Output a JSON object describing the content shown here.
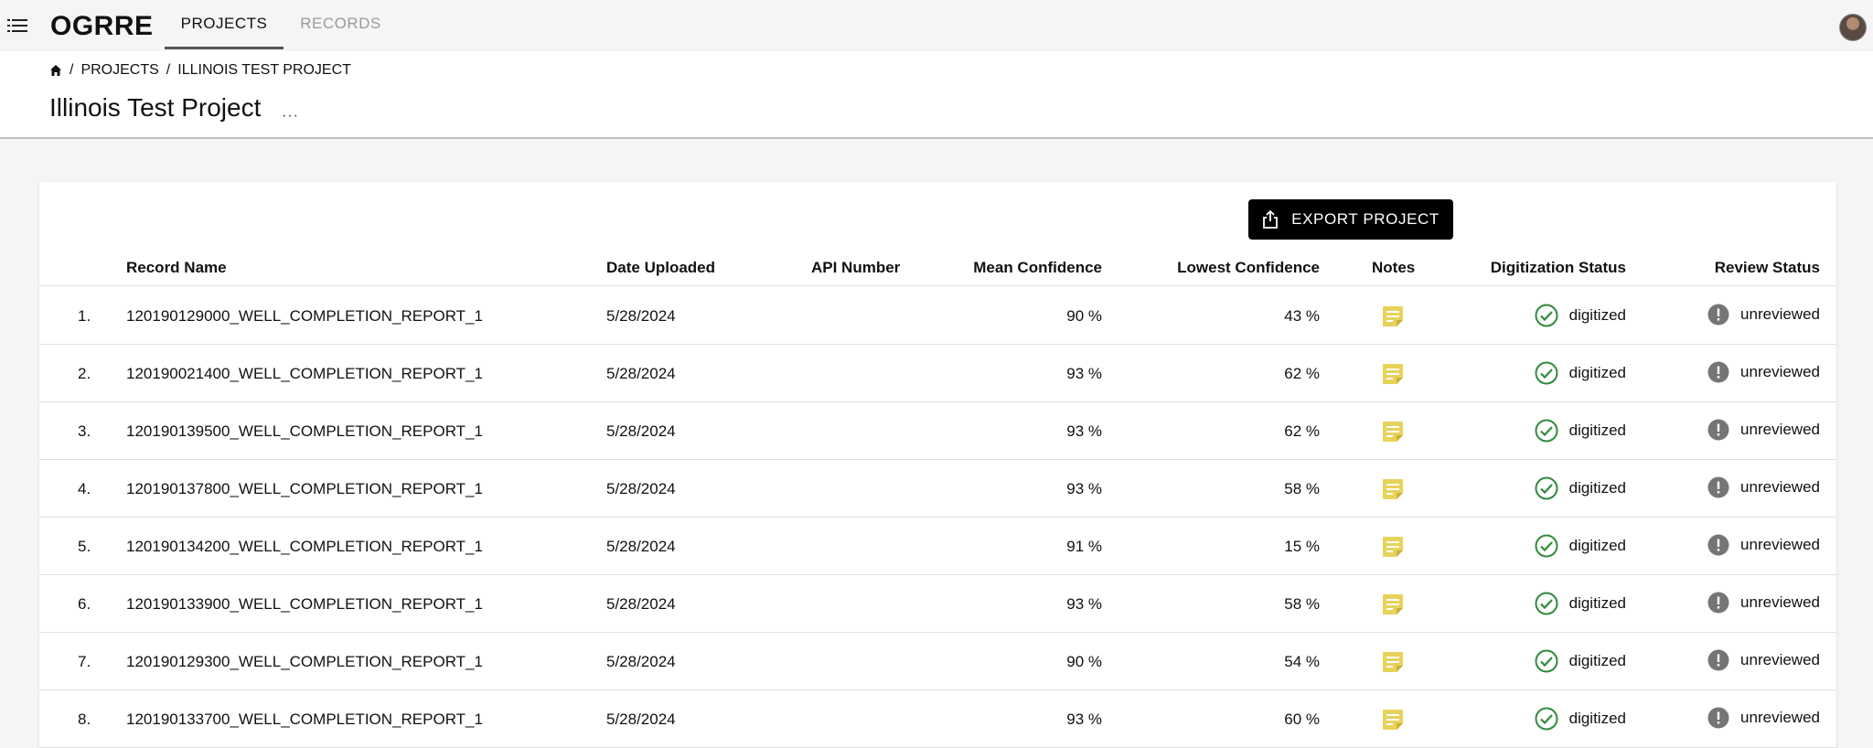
{
  "app": {
    "brand": "OGRRE",
    "nav": {
      "projects": "PROJECTS",
      "records": "RECORDS"
    }
  },
  "breadcrumb": {
    "sep1": "/",
    "projects": "PROJECTS",
    "sep2": "/",
    "current": "ILLINOIS TEST PROJECT"
  },
  "page": {
    "title": "Illinois Test Project",
    "more": "···"
  },
  "actions": {
    "export_label": "EXPORT PROJECT"
  },
  "table": {
    "headers": {
      "record_name": "Record Name",
      "date_uploaded": "Date Uploaded",
      "api_number": "API Number",
      "mean_confidence": "Mean Confidence",
      "lowest_confidence": "Lowest Confidence",
      "notes": "Notes",
      "digitization_status": "Digitization Status",
      "review_status": "Review Status"
    },
    "rows": [
      {
        "index": "1.",
        "name": "120190129000_WELL_COMPLETION_REPORT_1",
        "date": "5/28/2024",
        "api": "",
        "mean": "90 %",
        "lowest": "43 %",
        "digitization": "digitized",
        "review": "unreviewed"
      },
      {
        "index": "2.",
        "name": "120190021400_WELL_COMPLETION_REPORT_1",
        "date": "5/28/2024",
        "api": "",
        "mean": "93 %",
        "lowest": "62 %",
        "digitization": "digitized",
        "review": "unreviewed"
      },
      {
        "index": "3.",
        "name": "120190139500_WELL_COMPLETION_REPORT_1",
        "date": "5/28/2024",
        "api": "",
        "mean": "93 %",
        "lowest": "62 %",
        "digitization": "digitized",
        "review": "unreviewed"
      },
      {
        "index": "4.",
        "name": "120190137800_WELL_COMPLETION_REPORT_1",
        "date": "5/28/2024",
        "api": "",
        "mean": "93 %",
        "lowest": "58 %",
        "digitization": "digitized",
        "review": "unreviewed"
      },
      {
        "index": "5.",
        "name": "120190134200_WELL_COMPLETION_REPORT_1",
        "date": "5/28/2024",
        "api": "",
        "mean": "91 %",
        "lowest": "15 %",
        "digitization": "digitized",
        "review": "unreviewed"
      },
      {
        "index": "6.",
        "name": "120190133900_WELL_COMPLETION_REPORT_1",
        "date": "5/28/2024",
        "api": "",
        "mean": "93 %",
        "lowest": "58 %",
        "digitization": "digitized",
        "review": "unreviewed"
      },
      {
        "index": "7.",
        "name": "120190129300_WELL_COMPLETION_REPORT_1",
        "date": "5/28/2024",
        "api": "",
        "mean": "90 %",
        "lowest": "54 %",
        "digitization": "digitized",
        "review": "unreviewed"
      },
      {
        "index": "8.",
        "name": "120190133700_WELL_COMPLETION_REPORT_1",
        "date": "5/28/2024",
        "api": "",
        "mean": "93 %",
        "lowest": "60 %",
        "digitization": "digitized",
        "review": "unreviewed"
      }
    ]
  },
  "colors": {
    "note_icon": "#e8d25a",
    "digitized_check": "#2e8b3a",
    "unreviewed_alert": "#757575",
    "export_button": "#000000"
  },
  "icons": {
    "menu": "list-menu-icon",
    "home": "home-icon",
    "more": "more-horizontal-icon",
    "export": "share-export-icon",
    "note": "sticky-note-icon",
    "digitized": "check-circle-icon",
    "unreviewed": "alert-circle-icon"
  }
}
